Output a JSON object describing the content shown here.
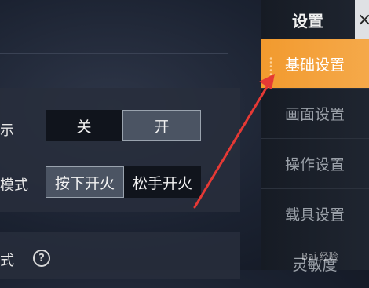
{
  "sidebar": {
    "title": "设置",
    "close": "×",
    "items": [
      {
        "label": "基础设置",
        "active": true
      },
      {
        "label": "画面设置",
        "active": false
      },
      {
        "label": "操作设置",
        "active": false
      },
      {
        "label": "载具设置",
        "active": false
      },
      {
        "label": "灵敏度",
        "active": false
      }
    ]
  },
  "settings": {
    "row1": {
      "label": "示",
      "options": [
        "关",
        "开"
      ],
      "selected": "开"
    },
    "row2": {
      "label": "模式",
      "options": [
        "按下开火",
        "松手开火"
      ],
      "selected": "按下开火"
    },
    "row3": {
      "label": "式"
    }
  },
  "help_icon": "?",
  "watermark": "Bai 经验",
  "colors": {
    "accent": "#f29a2e",
    "arrow": "#e53935"
  }
}
